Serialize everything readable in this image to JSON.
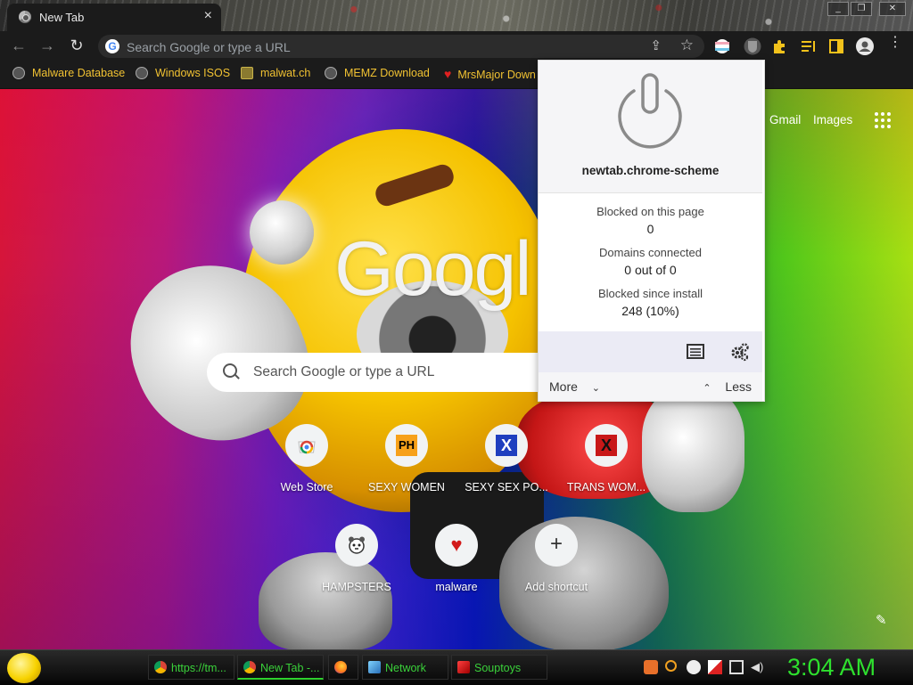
{
  "window": {
    "tab_title": "New Tab",
    "tab_close": "×",
    "controls": [
      "_",
      "❐",
      "✕"
    ]
  },
  "toolbar": {
    "back": "←",
    "forward": "→",
    "reload": "↻",
    "omnibox_placeholder": "Search Google or type a URL",
    "share": "⇪",
    "star": "☆"
  },
  "bookmarks": [
    {
      "label": "Malware Database",
      "icon": "globe-icon"
    },
    {
      "label": "Windows ISOS",
      "icon": "globe-icon"
    },
    {
      "label": "malwat.ch",
      "icon": "figure-icon"
    },
    {
      "label": "MEMZ Download",
      "icon": "globe-icon"
    },
    {
      "label": "MrsMajor Down",
      "icon": "heart-icon"
    }
  ],
  "ntp": {
    "logo": "Googl",
    "links": {
      "gmail": "Gmail",
      "images": "Images"
    },
    "search_placeholder": "Search Google or type a URL",
    "shortcuts": [
      {
        "name": "Web Store",
        "icon": "webstore-icon"
      },
      {
        "name": "SEXY WOMEN",
        "icon": "ph-icon",
        "glyph": "PH"
      },
      {
        "name": "SEXY SEX PO...",
        "icon": "x-blue-icon",
        "glyph": "X"
      },
      {
        "name": "TRANS WOM...",
        "icon": "x-red-icon",
        "glyph": "X"
      },
      {
        "name": "HAMPSTERS",
        "icon": "hamster-icon"
      },
      {
        "name": "malware",
        "icon": "heart-icon"
      },
      {
        "name": "Add shortcut",
        "icon": "plus-icon",
        "glyph": "+"
      }
    ],
    "customize": "✎"
  },
  "popup": {
    "domain": "newtab.chrome-scheme",
    "blocked_on_page_label": "Blocked on this page",
    "blocked_on_page_value": "0",
    "domains_connected_label": "Domains connected",
    "domains_connected_value": "0 out of 0",
    "blocked_since_install_label": "Blocked since install",
    "blocked_since_install_value": "248 (10%)",
    "more": "More",
    "less": "Less"
  },
  "taskbar": {
    "tasks": [
      {
        "label": "https://tm...",
        "icon": "chrome-icon"
      },
      {
        "label": "New Tab -...",
        "icon": "chrome-icon",
        "active": true
      },
      {
        "label": "",
        "icon": "firefox-icon"
      },
      {
        "label": "Network",
        "icon": "network-icon"
      },
      {
        "label": "Souptoys",
        "icon": "souptoys-icon"
      }
    ],
    "clock": "3:04 AM"
  },
  "colors": {
    "bookmark_text": "#f1c232",
    "taskbar_text": "#3ad13a",
    "clock": "#2ee02e",
    "popup_toolbar": "#ebebf5"
  }
}
